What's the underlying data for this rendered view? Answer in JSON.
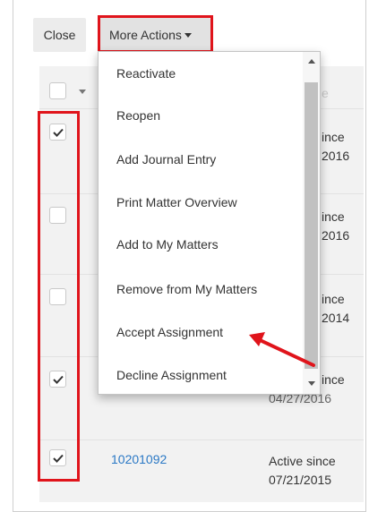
{
  "toolbar": {
    "close_label": "Close",
    "more_actions_label": "More Actions"
  },
  "menu": {
    "items": [
      "Reactivate",
      "Reopen",
      "Add Journal Entry",
      "Print Matter Overview",
      "Add to My Matters",
      "Remove from My Matters",
      "Accept Assignment",
      "Decline Assignment"
    ]
  },
  "rows": [
    {
      "checked": true,
      "status_line1": "ince",
      "status_line2": "2016"
    },
    {
      "checked": false,
      "status_line1": "ince",
      "status_line2": "2016"
    },
    {
      "checked": false,
      "status_line1": "ince",
      "status_line2": "2014"
    },
    {
      "checked": true,
      "status_line1": "ince",
      "status_line2": "04/27/2016"
    },
    {
      "checked": true,
      "matter_number": "10201092",
      "status_line1": "Active since",
      "status_line2": "07/21/2015"
    }
  ],
  "header": {
    "partial_label": "e"
  },
  "colors": {
    "highlight": "#e0141b",
    "link": "#2a78c5"
  }
}
